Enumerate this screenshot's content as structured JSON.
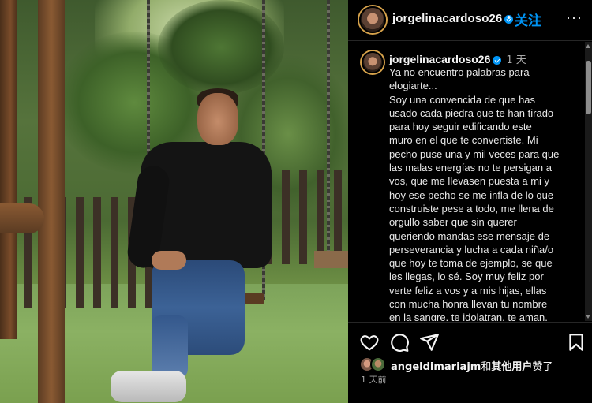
{
  "post": {
    "username": "jorgelinacardoso26",
    "follow_label": "关注",
    "separator": "•",
    "more_label": "···"
  },
  "caption": {
    "username": "jorgelinacardoso26",
    "time": "1 天",
    "text": "Ya no encuentro palabras para\nelogiarte...\nSoy una convencida de que has\nusado cada piedra que te han tirado\npara hoy seguir edificando este\nmuro en el que te convertiste. Mi\npecho puse una y mil veces para que\nlas malas energías no te persigan a\nvos, que me llevasen puesta a mi y\nhoy ese pecho se me infla de lo que\nconstruiste pese a todo, me llena de\norgullo saber que sin querer\nqueriendo mandas ese mensaje de\nperseverancia y lucha a cada niña/o\nque hoy te toma de ejemplo, se que\nles llegas, lo sé. Soy muy feliz por\nverte feliz a vos y a mis hijas, ellas\ncon mucha honra llevan tu nombre\nen la sangre, te idolatran, te aman."
  },
  "actions": {
    "like_icon": "heart-icon",
    "comment_icon": "comment-icon",
    "share_icon": "send-icon",
    "save_icon": "bookmark-icon"
  },
  "likes": {
    "liker": "angeldimariajm",
    "middle": "和",
    "others": "其他用户",
    "suffix": "赞了"
  },
  "timestamp": "1 天前",
  "colors": {
    "accent": "#0095f6",
    "background": "#000000",
    "secondary_text": "#a8a8a8"
  }
}
